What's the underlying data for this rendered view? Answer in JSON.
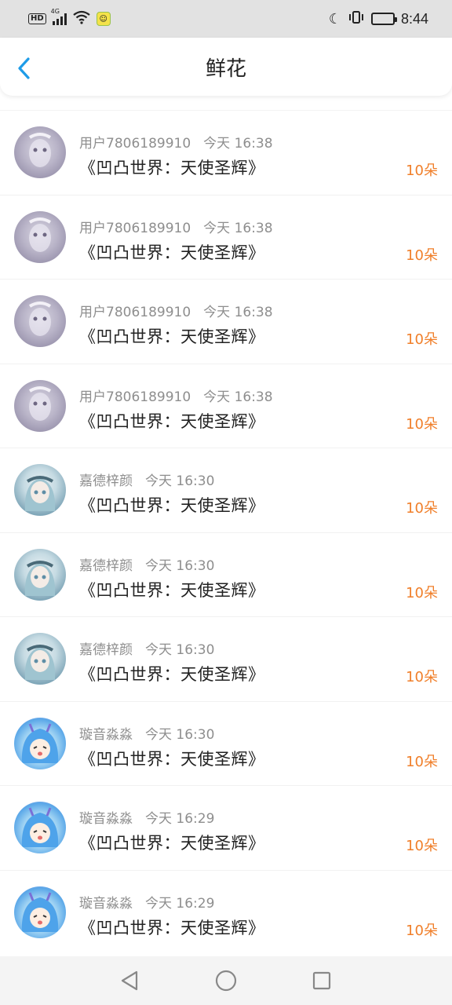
{
  "status_bar": {
    "hd": "HD",
    "network": "4G",
    "time": "8:44",
    "icons": [
      "hd-icon",
      "signal-icon",
      "wifi-icon",
      "app-notification-icon",
      "moon-icon",
      "vibrate-icon",
      "battery-icon"
    ]
  },
  "header": {
    "title": "鲜花",
    "back_icon": "chevron-left-icon",
    "accent_color": "#1e9ce8"
  },
  "colors": {
    "count_color": "#f07f2a",
    "meta_color": "#8e8e8e"
  },
  "items": [
    {
      "avatar": "gray",
      "user": "用户7806189910",
      "time": "今天 16:38",
      "text": "《凹凸世界：天使圣辉》",
      "count": "10朵"
    },
    {
      "avatar": "gray",
      "user": "用户7806189910",
      "time": "今天 16:38",
      "text": "《凹凸世界：天使圣辉》",
      "count": "10朵"
    },
    {
      "avatar": "gray",
      "user": "用户7806189910",
      "time": "今天 16:38",
      "text": "《凹凸世界：天使圣辉》",
      "count": "10朵"
    },
    {
      "avatar": "gray",
      "user": "用户7806189910",
      "time": "今天 16:38",
      "text": "《凹凸世界：天使圣辉》",
      "count": "10朵"
    },
    {
      "avatar": "girl",
      "user": "嘉德梓颜",
      "time": "今天 16:30",
      "text": "《凹凸世界：天使圣辉》",
      "count": "10朵"
    },
    {
      "avatar": "girl",
      "user": "嘉德梓颜",
      "time": "今天 16:30",
      "text": "《凹凸世界：天使圣辉》",
      "count": "10朵"
    },
    {
      "avatar": "girl",
      "user": "嘉德梓颜",
      "time": "今天 16:30",
      "text": "《凹凸世界：天使圣辉》",
      "count": "10朵"
    },
    {
      "avatar": "anime",
      "user": "璇音淼淼",
      "time": "今天 16:30",
      "text": "《凹凸世界：天使圣辉》",
      "count": "10朵"
    },
    {
      "avatar": "anime",
      "user": "璇音淼淼",
      "time": "今天 16:29",
      "text": "《凹凸世界：天使圣辉》",
      "count": "10朵"
    },
    {
      "avatar": "anime",
      "user": "璇音淼淼",
      "time": "今天 16:29",
      "text": "《凹凸世界：天使圣辉》",
      "count": "10朵"
    }
  ],
  "nav_bar": {
    "icons": [
      "back-triangle-icon",
      "home-circle-icon",
      "recent-square-icon"
    ]
  }
}
